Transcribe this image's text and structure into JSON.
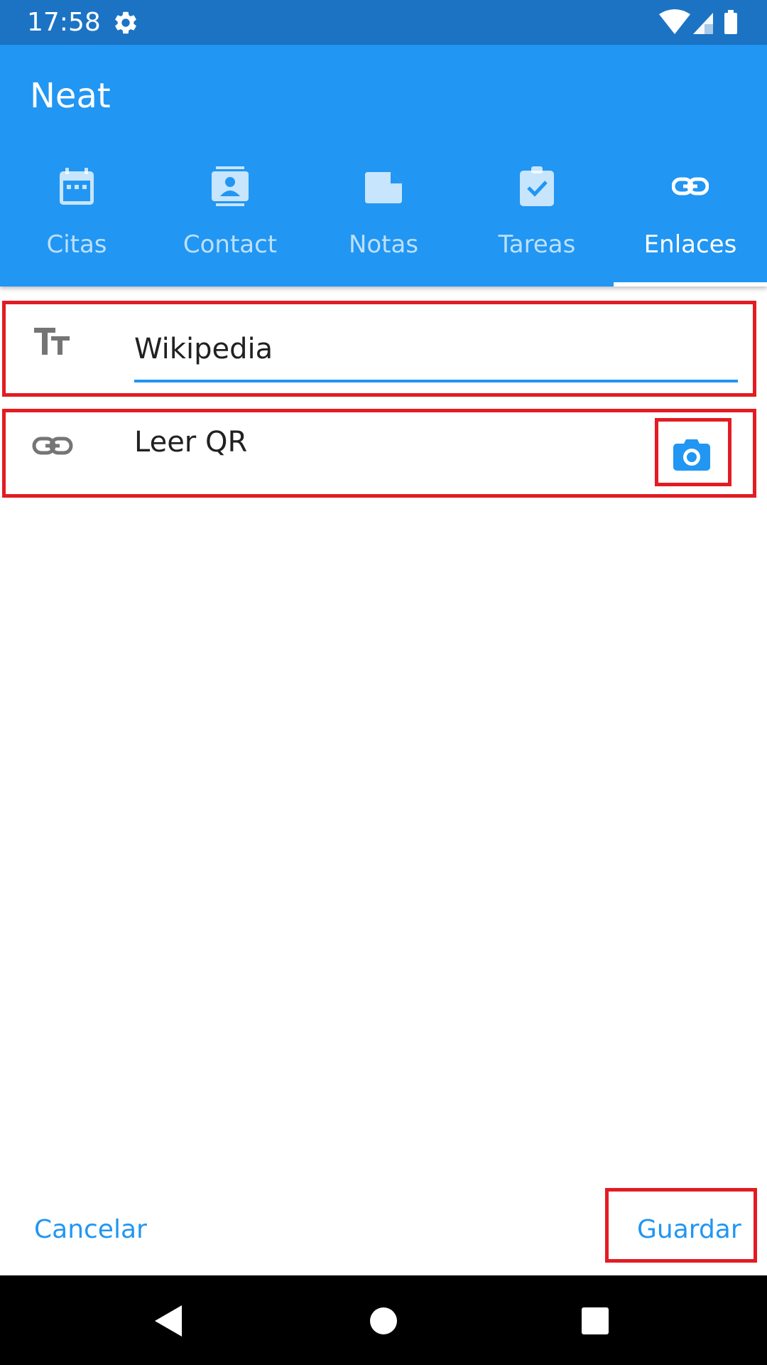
{
  "status_bar": {
    "time": "17:58",
    "icons": [
      "gear-icon",
      "wifi-icon",
      "signal-icon",
      "battery-icon"
    ]
  },
  "app_bar": {
    "title": "Neat",
    "background_color": "#2196f3",
    "tabs": [
      {
        "label": "Citas",
        "icon": "calendar-icon",
        "active": false
      },
      {
        "label": "Contact",
        "icon": "contact-card-icon",
        "active": false
      },
      {
        "label": "Notas",
        "icon": "note-icon",
        "active": false
      },
      {
        "label": "Tareas",
        "icon": "task-clipboard-icon",
        "active": false
      },
      {
        "label": "Enlaces",
        "icon": "link-icon",
        "active": true
      }
    ]
  },
  "form": {
    "title_field": {
      "icon": "text-size-icon",
      "value": "Wikipedia"
    },
    "link_field": {
      "icon": "link-icon",
      "value": "Leer QR",
      "action_icon": "camera-icon"
    }
  },
  "footer": {
    "cancel_label": "Cancelar",
    "save_label": "Guardar"
  },
  "accent_color": "#2196f3",
  "highlight_color": "#e31b23"
}
